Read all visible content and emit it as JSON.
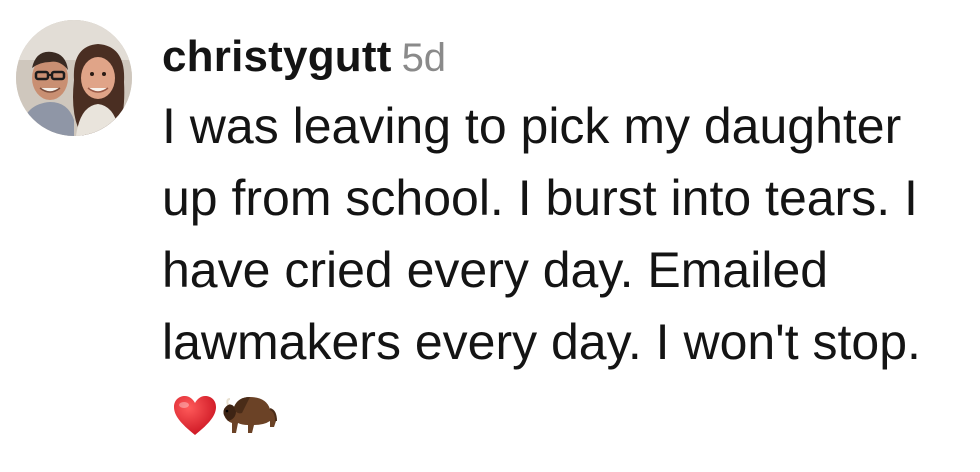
{
  "comment": {
    "username": "christygutt",
    "timestamp": "5d",
    "text": "I was leaving to pick my daughter up from school. I burst into tears. I have cried every day. Emailed lawmakers every day. I won't stop.",
    "emojis": [
      "red-heart-icon",
      "bison-icon"
    ]
  }
}
